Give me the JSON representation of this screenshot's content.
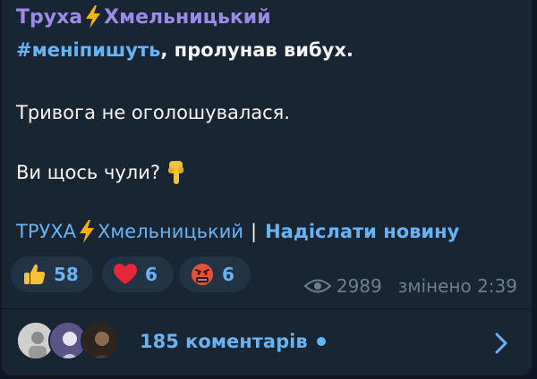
{
  "post": {
    "author": {
      "name_part1": "Труха",
      "name_part2": "Хмельницький",
      "color": "#9b8ae8"
    },
    "body": {
      "hashtag": "#меніпишуть",
      "line1_rest": ", пролунав вибух.",
      "line2": "Тривога не оголошувалася.",
      "line3": "Ви щось чули?",
      "line3_emoji": "pointing-down-hand-icon"
    },
    "footer": {
      "channel_part1": "ТРУХА",
      "channel_part2": "Хмельницький",
      "separator": "|",
      "cta": "Надіслати новину"
    },
    "reactions": [
      {
        "icon": "thumbs-up-icon",
        "count": "58"
      },
      {
        "icon": "red-heart-icon",
        "count": "6"
      },
      {
        "icon": "angry-face-icon",
        "count": "6"
      }
    ],
    "meta": {
      "views_icon": "eye-icon",
      "views": "2989",
      "edited": "змінено 2:39"
    },
    "comments": {
      "label": "185 коментарів",
      "unread_dot": true,
      "chevron_icon": "chevron-right-icon"
    }
  },
  "colors": {
    "background": "#0e1621",
    "bubble": "#182533",
    "link": "#6ab3f3",
    "text": "#f5f5f5",
    "muted": "#6d7f8f"
  }
}
